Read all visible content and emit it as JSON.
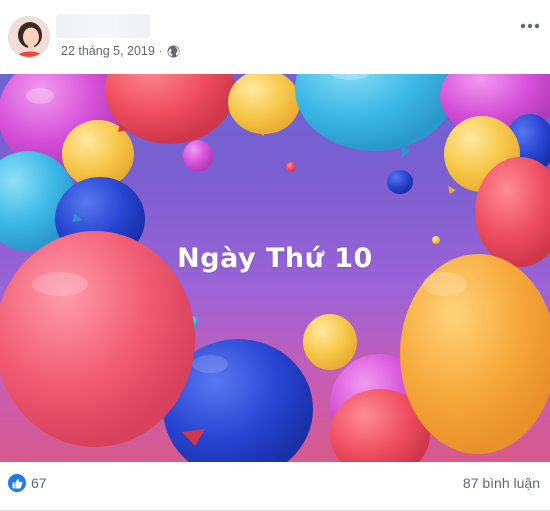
{
  "post": {
    "author_name": "",
    "date": "22 tháng 5, 2019",
    "separator": "·",
    "privacy_icon": "globe-icon",
    "more_icon": "more-options-icon"
  },
  "photo": {
    "caption": "Ngày Thứ 10",
    "description_colors": {
      "background_top": "#6d63d6",
      "background_bottom": "#d65a8a"
    }
  },
  "footer": {
    "like_icon": "like-icon",
    "reaction_count": "67",
    "comments_label": "87 bình luận"
  },
  "colors": {
    "like_blue": "#2078f4",
    "meta_gray": "#616770"
  }
}
